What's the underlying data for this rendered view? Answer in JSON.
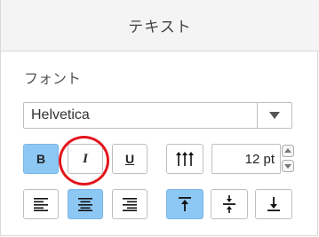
{
  "panel": {
    "title": "テキスト",
    "font_section_label": "フォント"
  },
  "font": {
    "selected": "Helvetica"
  },
  "style_buttons": {
    "bold": {
      "label": "B",
      "active": true
    },
    "italic": {
      "label": "I",
      "active": false
    },
    "underline": {
      "label": "U",
      "active": false
    }
  },
  "size": {
    "value": "12 pt"
  },
  "align": {
    "left": {
      "active": false
    },
    "center": {
      "active": true
    },
    "right": {
      "active": false
    }
  },
  "valign": {
    "top": {
      "active": true
    },
    "middle": {
      "active": false
    },
    "bottom": {
      "active": false
    }
  },
  "colors": {
    "active_bg": "#8dc8f5",
    "highlight": "#e2161c",
    "border": "#bfbfbf"
  },
  "icons": {
    "dropdown": "chevron-down-icon",
    "line_spacing": "line-spacing-icon",
    "stepper_up": "caret-up-icon",
    "stepper_down": "caret-down-icon"
  }
}
